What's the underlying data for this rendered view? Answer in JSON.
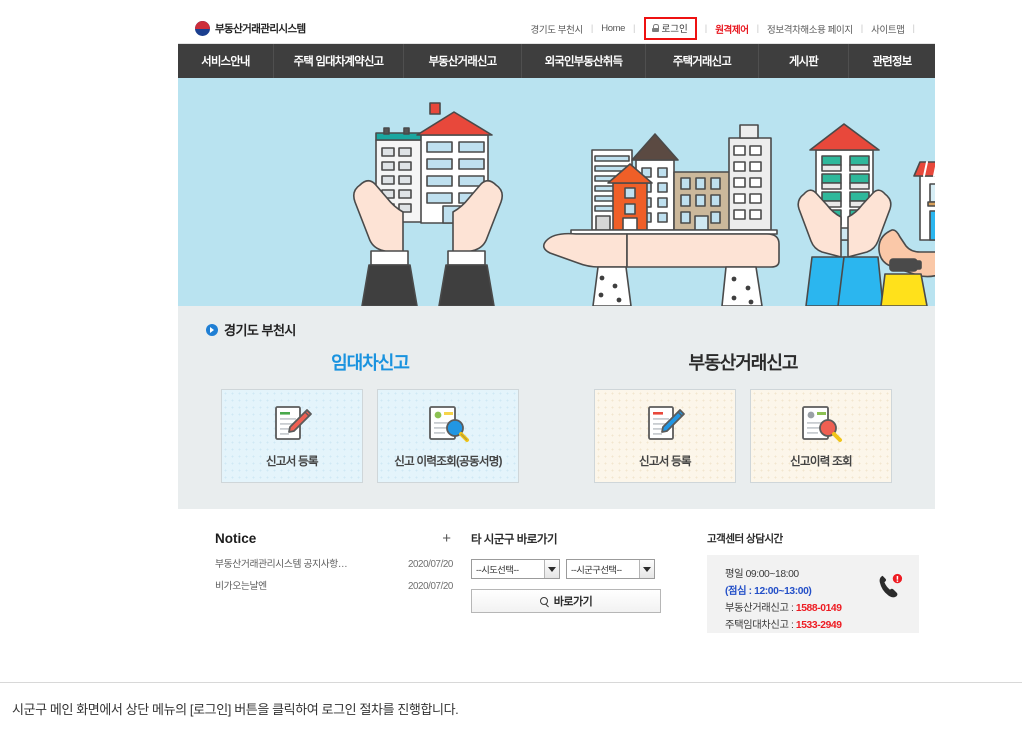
{
  "header": {
    "logo_text": "부동산거래관리시스템",
    "logo_icon": "taegeuk-icon",
    "region": "경기도 부천시",
    "home": "Home",
    "login": "로그인",
    "login_icon": "lock-icon",
    "remote": "원격제어",
    "accessibility": "정보격차해소용 페이지",
    "sitemap": "사이트맵",
    "separator": "|"
  },
  "gnb": {
    "items": [
      "서비스안내",
      "주택 임대차계약신고",
      "부동산거래신고",
      "외국인부동산취득",
      "주택거래신고",
      "게시판",
      "관련정보"
    ]
  },
  "region_panel": {
    "title": "경기도 부천시",
    "groups": [
      {
        "title": "임대차신고",
        "color": "#1a93df",
        "cards": [
          {
            "label": "신고서 등록",
            "icon": "document-pencil-icon",
            "theme": "blue"
          },
          {
            "label": "신고 이력조회(공동서명)",
            "icon": "document-search-icon",
            "theme": "blue"
          }
        ]
      },
      {
        "title": "부동산거래신고",
        "color": "#2b2b2b",
        "cards": [
          {
            "label": "신고서 등록",
            "icon": "document-pencil-icon",
            "theme": "cream"
          },
          {
            "label": "신고이력 조회",
            "icon": "document-search-icon",
            "theme": "cream"
          }
        ]
      }
    ]
  },
  "notice": {
    "title": "Notice",
    "more": "+",
    "items": [
      {
        "text": "부동산거래관리시스템 공지사항…",
        "date": "2020/07/20"
      },
      {
        "text": "비가오는날엔",
        "date": "2020/07/20"
      }
    ]
  },
  "shortcut": {
    "title": "타 시군구 바로가기",
    "sido_value": "--시도선택--",
    "sigungu_value": "--시군구선택--",
    "go_label": "바로가기",
    "go_icon": "search-icon"
  },
  "customer_center": {
    "title": "고객센터 상담시간",
    "weekday": "평일 09:00~18:00",
    "lunch": "(점심 : 12:00~13:00)",
    "line1_label": "부동산거래신고 : ",
    "line1_number": "1588-0149",
    "line2_label": "주택임대차신고 : ",
    "line2_number": "1533-2949",
    "phone_icon": "phone-icon"
  },
  "caption": {
    "text": "시군구 메인 화면에서 상단 메뉴의 [로그인] 버튼을 클릭하여 로그인 절차를 진행합니다."
  },
  "colors": {
    "accent_red": "#ee1c23",
    "accent_blue": "#1a93df",
    "gnb_bg": "#3e3e3e",
    "hero_bg": "#b9e3f0",
    "panel_bg": "#e9edee",
    "highlight_border": "#ee1111"
  }
}
